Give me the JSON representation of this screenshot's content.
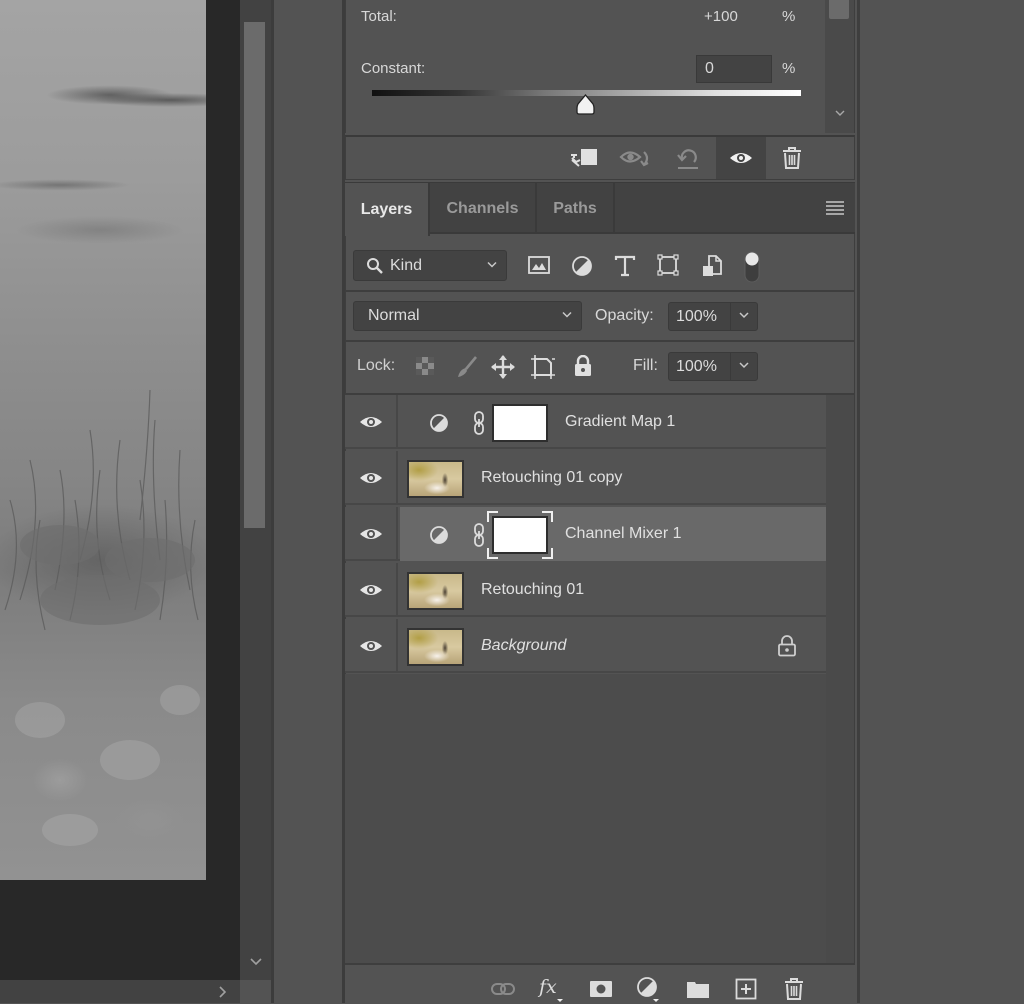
{
  "canvas": {
    "description": "grayscale grass field photo (Channel Mixer monochrome)",
    "vscroll_down_icon": "chevron-down",
    "hscroll_right_icon": "chevron-right"
  },
  "properties": {
    "total_label": "Total:",
    "total_value": "+100",
    "total_unit": "%",
    "constant_label": "Constant:",
    "constant_value": "0",
    "constant_unit": "%",
    "constant_slider_value_percent": 0,
    "toolbar": [
      {
        "icon": "clip-to-layer-icon",
        "label": "Clip to layer"
      },
      {
        "icon": "view-previous-state-icon",
        "label": "View previous state"
      },
      {
        "icon": "reset-adjustment-icon",
        "label": "Reset to adjustment defaults"
      },
      {
        "icon": "toggle-visibility-icon",
        "label": "Toggle layer visibility",
        "active": true
      },
      {
        "icon": "delete-adjustment-icon",
        "label": "Delete this adjustment layer"
      }
    ]
  },
  "layers_panel": {
    "tabs": [
      {
        "label": "Layers",
        "active": true
      },
      {
        "label": "Channels",
        "active": false
      },
      {
        "label": "Paths",
        "active": false
      }
    ],
    "filter": {
      "kind_label": "Kind",
      "filter_icons": [
        "pixel-layer-filter-icon",
        "adjustment-layer-filter-icon",
        "type-layer-filter-icon",
        "shape-layer-filter-icon",
        "smart-object-filter-icon",
        "filter-toggle-icon"
      ]
    },
    "blend_mode": "Normal",
    "opacity_label": "Opacity:",
    "opacity_value": "100%",
    "lock_label": "Lock:",
    "lock_icons": [
      "lock-transparent-pixels-icon",
      "lock-image-pixels-icon",
      "lock-position-icon",
      "lock-artboard-icon",
      "lock-all-icon"
    ],
    "fill_label": "Fill:",
    "fill_value": "100%",
    "layers": [
      {
        "name": "Gradient Map 1",
        "type": "adjustment",
        "visible": true,
        "selected": false,
        "locked": false,
        "italic": false
      },
      {
        "name": "Retouching 01 copy",
        "type": "pixel",
        "visible": true,
        "selected": false,
        "locked": false,
        "italic": false
      },
      {
        "name": "Channel Mixer 1",
        "type": "adjustment",
        "visible": true,
        "selected": true,
        "locked": false,
        "italic": false
      },
      {
        "name": "Retouching 01",
        "type": "pixel",
        "visible": true,
        "selected": false,
        "locked": false,
        "italic": false
      },
      {
        "name": "Background",
        "type": "pixel",
        "visible": true,
        "selected": false,
        "locked": true,
        "italic": true
      }
    ],
    "footer_icons": [
      {
        "icon": "link-layers-icon",
        "label": "Link layers"
      },
      {
        "icon": "fx-icon",
        "label": "Add a layer style"
      },
      {
        "icon": "add-mask-icon",
        "label": "Add a mask"
      },
      {
        "icon": "new-adjustment-layer-icon",
        "label": "Create new fill or adjustment layer"
      },
      {
        "icon": "new-group-icon",
        "label": "Create a new group"
      },
      {
        "icon": "new-layer-icon",
        "label": "Create a new layer"
      },
      {
        "icon": "delete-layer-icon",
        "label": "Delete layer"
      }
    ]
  },
  "colors": {
    "panel_bg": "#535353",
    "panel_dark": "#424242",
    "selected_row": "#696969",
    "canvas_bg": "#282828",
    "text": "#e0e0e0"
  }
}
